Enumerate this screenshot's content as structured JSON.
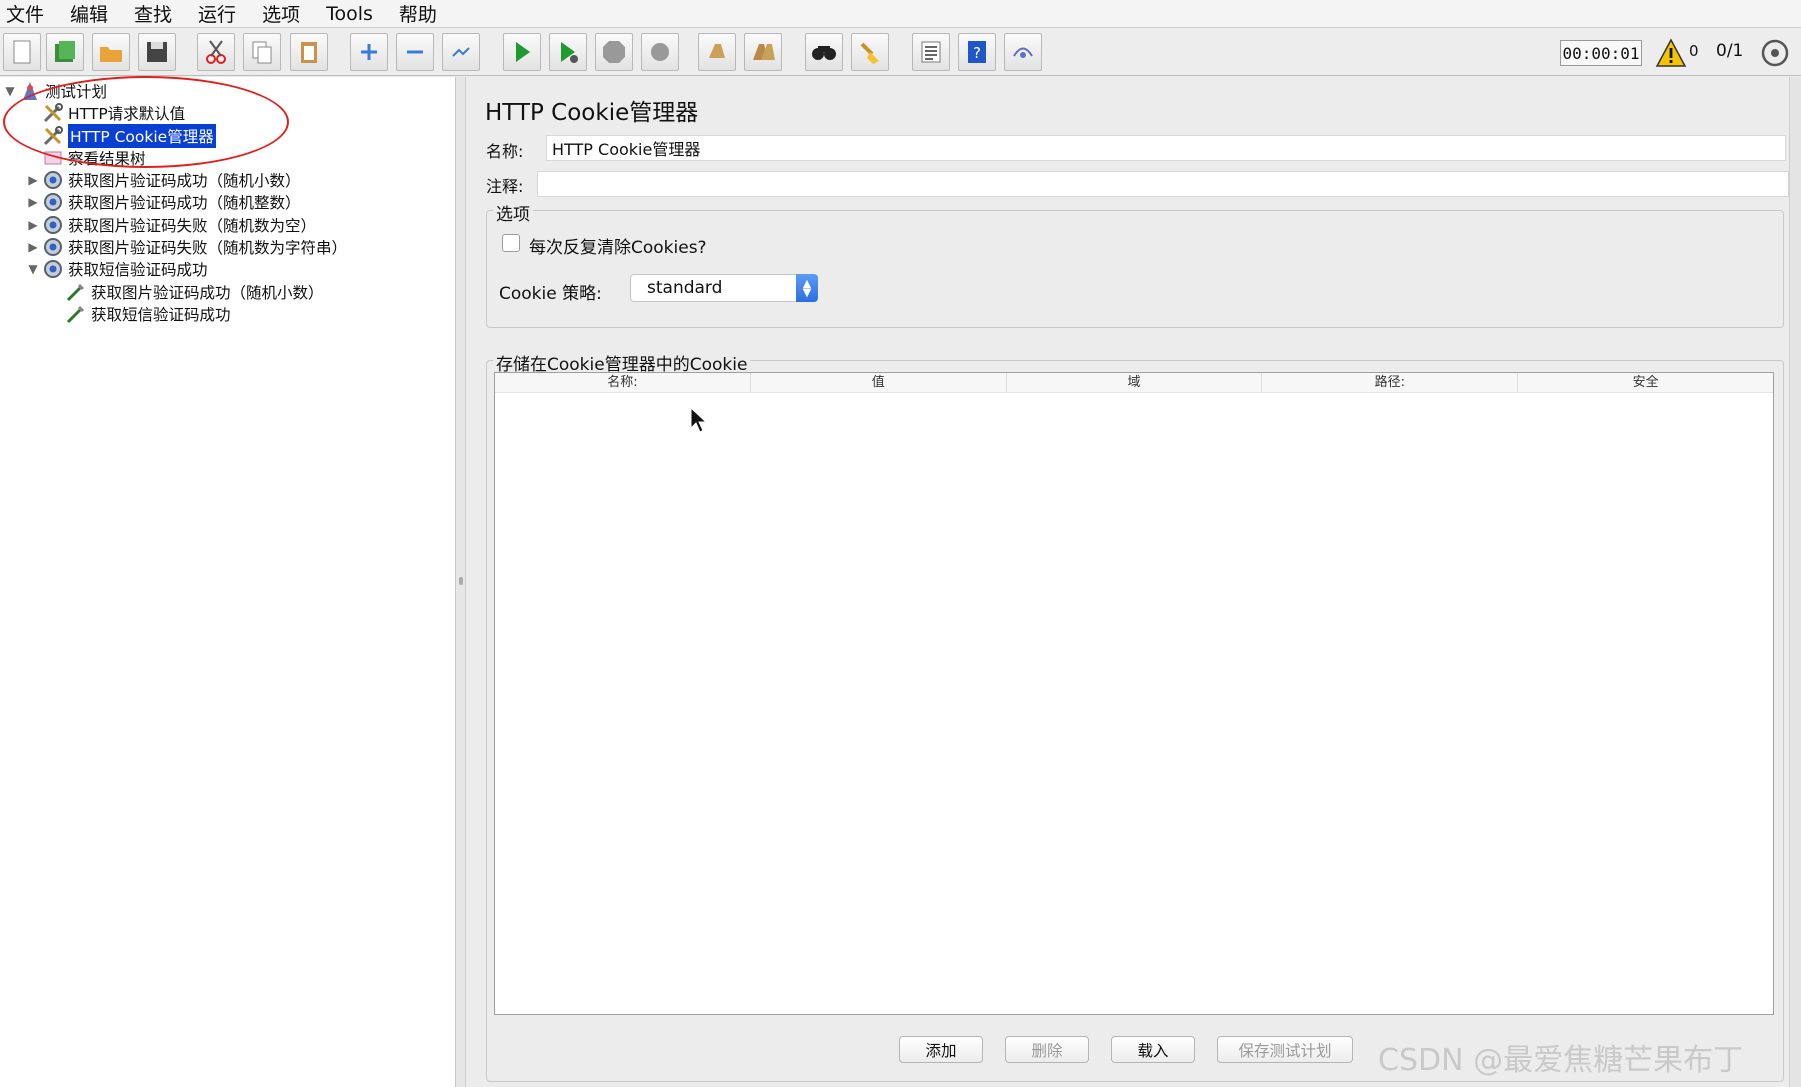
{
  "menu": [
    "文件",
    "编辑",
    "查找",
    "运行",
    "选项",
    "Tools",
    "帮助"
  ],
  "toolbar": {
    "icons": [
      "new-icon",
      "templates-icon",
      "open-icon",
      "save-icon",
      "cut-icon",
      "copy-icon",
      "paste-icon",
      "expand-icon",
      "collapse-icon",
      "toggle-icon",
      "start-icon",
      "start-no-pause-icon",
      "stop-icon",
      "shutdown-icon",
      "clear-icon",
      "clear-all-icon",
      "search-icon",
      "reset-search-icon",
      "function-helper-icon",
      "help-icon",
      "remote-icon"
    ],
    "timer": "00:00:01",
    "warning_count": "0",
    "threads": "0/1"
  },
  "tree": {
    "items": [
      {
        "label": "测试计划",
        "icon": "test-plan-icon",
        "twisty": "▼",
        "level": 0
      },
      {
        "label": "HTTP请求默认值",
        "icon": "tools-icon",
        "twisty": "",
        "level": 1
      },
      {
        "label": "HTTP Cookie管理器",
        "icon": "tools-icon",
        "twisty": "",
        "level": 1,
        "selected": true
      },
      {
        "label": "察看结果树",
        "icon": "listener-icon",
        "twisty": "",
        "level": 1
      },
      {
        "label": "获取图片验证码成功（随机小数）",
        "icon": "thread-group-icon",
        "twisty": "▶",
        "level": 1
      },
      {
        "label": "获取图片验证码成功（随机整数）",
        "icon": "thread-group-icon",
        "twisty": "▶",
        "level": 1
      },
      {
        "label": "获取图片验证码失败（随机数为空）",
        "icon": "thread-group-icon",
        "twisty": "▶",
        "level": 1
      },
      {
        "label": "获取图片验证码失败（随机数为字符串）",
        "icon": "thread-group-icon",
        "twisty": "▶",
        "level": 1
      },
      {
        "label": "获取短信验证码成功",
        "icon": "thread-group-icon",
        "twisty": "▼",
        "level": 1
      },
      {
        "label": "获取图片验证码成功（随机小数）",
        "icon": "sampler-icon",
        "twisty": "",
        "level": 2
      },
      {
        "label": "获取短信验证码成功",
        "icon": "sampler-icon",
        "twisty": "",
        "level": 2
      }
    ]
  },
  "panel": {
    "title": "HTTP Cookie管理器",
    "name_label": "名称:",
    "name_value": "HTTP Cookie管理器",
    "comment_label": "注释:",
    "comment_value": "",
    "options_title": "选项",
    "clear_each_iteration_label": "每次反复清除Cookies?",
    "clear_each_iteration_checked": false,
    "policy_label": "Cookie 策略:",
    "policy_value": "standard",
    "stored_title": "存储在Cookie管理器中的Cookie",
    "columns": [
      "名称:",
      "值",
      "域",
      "路径:",
      "安全"
    ],
    "buttons": {
      "add": "添加",
      "delete": "删除",
      "load": "载入",
      "save": "保存测试计划"
    }
  },
  "watermark": "CSDN @最爱焦糖芒果布丁",
  "colors": {
    "selection": "#0a3fd6",
    "annotation": "#e0201c"
  }
}
